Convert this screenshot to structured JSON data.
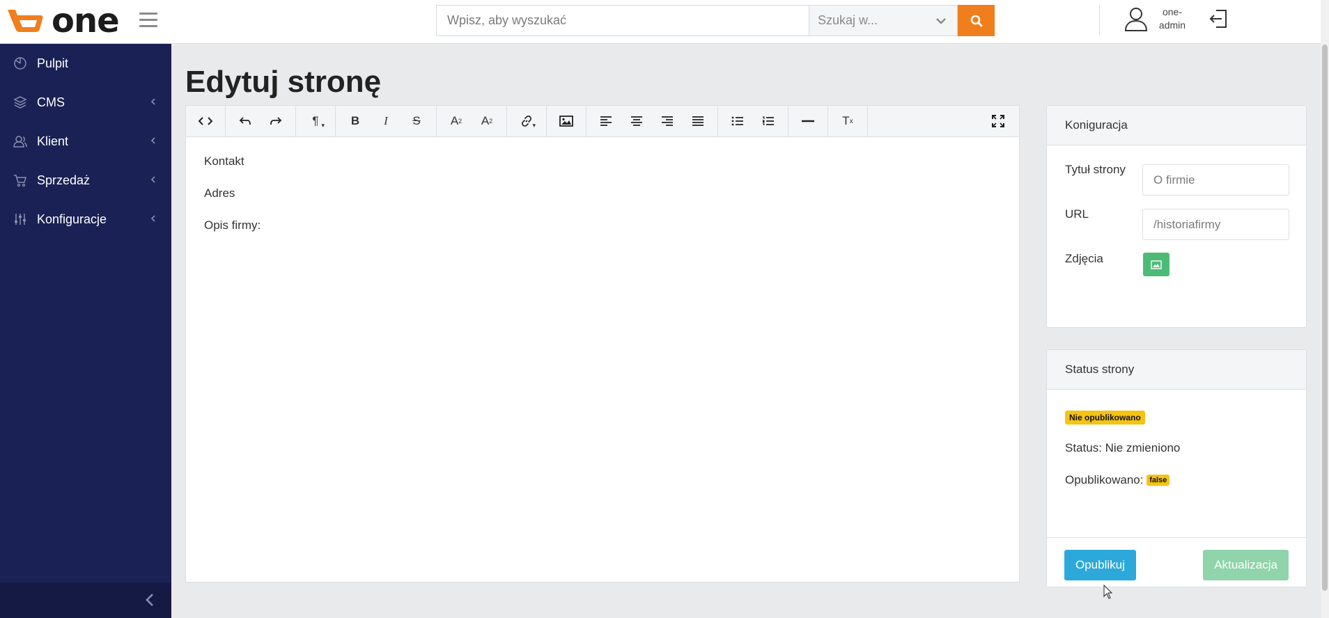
{
  "app": {
    "logo_text": "one"
  },
  "header": {
    "search_placeholder": "Wpisz, aby wyszukać",
    "search_scope": "Szukaj w...",
    "user_name_line1": "one-",
    "user_name_line2": "admin"
  },
  "sidebar": {
    "items": [
      {
        "label": "Pulpit",
        "icon": "dashboard-icon",
        "has_arrow": false
      },
      {
        "label": "CMS",
        "icon": "layers-icon",
        "has_arrow": true
      },
      {
        "label": "Klient",
        "icon": "users-icon",
        "has_arrow": true
      },
      {
        "label": "Sprzedaż",
        "icon": "cart-icon",
        "has_arrow": true
      },
      {
        "label": "Konfiguracje",
        "icon": "sliders-icon",
        "has_arrow": true
      }
    ]
  },
  "page": {
    "title": "Edytuj stronę"
  },
  "editor": {
    "lines": [
      "Kontakt",
      "Adres",
      "Opis firmy:"
    ]
  },
  "config": {
    "header": "Koniguracja",
    "title_label": "Tytuł strony",
    "title_placeholder": "O firmie",
    "url_label": "URL",
    "url_placeholder": "/historiafirmy",
    "photos_label": "Zdjęcia"
  },
  "status": {
    "header": "Status strony",
    "badge": "Nie opublikowano",
    "status_text": "Status: Nie zmieniono",
    "published_label": "Opublikowano:",
    "published_value": "false",
    "publish_button": "Opublikuj",
    "update_button": "Aktualizacja"
  },
  "colors": {
    "brand": "#f07e1c",
    "sidebar": "#1a2154",
    "badge": "#f5c311",
    "publish": "#2ca9da",
    "update": "#8fd4aa",
    "image_button": "#4dbb78"
  }
}
